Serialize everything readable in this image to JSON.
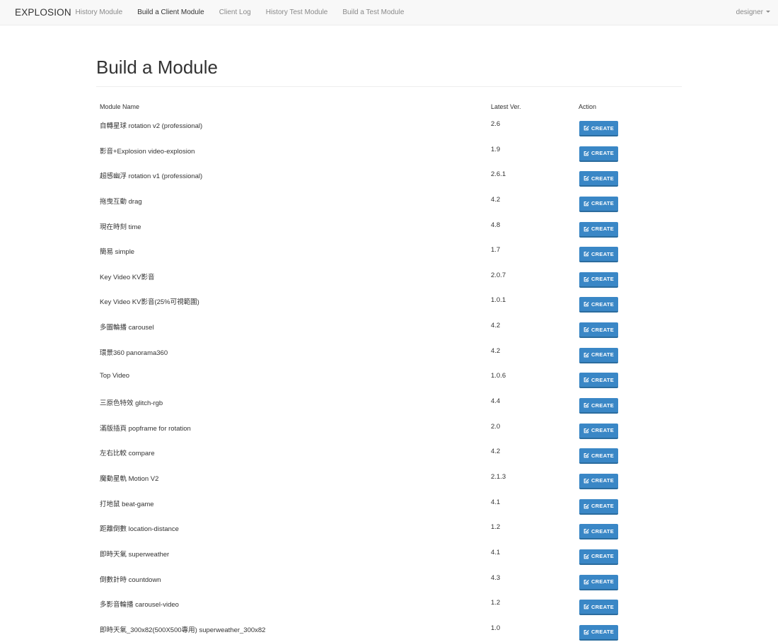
{
  "navbar": {
    "brand": "EXPLOSION",
    "links": [
      {
        "label": "History Module",
        "active": false
      },
      {
        "label": "Build a Client Module",
        "active": true
      },
      {
        "label": "Client Log",
        "active": false
      },
      {
        "label": "History Test Module",
        "active": false
      },
      {
        "label": "Build a Test Module",
        "active": false
      }
    ],
    "user": "designer"
  },
  "page": {
    "title": "Build a Module"
  },
  "table": {
    "headers": {
      "name": "Module Name",
      "version": "Latest Ver.",
      "action": "Action"
    },
    "action_label": "CREATE",
    "action_icon": "check-square-icon",
    "rows": [
      {
        "name": "自轉星球 rotation v2 (professional)",
        "version": "2.6"
      },
      {
        "name": "影音+Explosion video-explosion",
        "version": "1.9"
      },
      {
        "name": "超感幽浮 rotation v1 (professional)",
        "version": "2.6.1"
      },
      {
        "name": "拖曳互動 drag",
        "version": "4.2"
      },
      {
        "name": "現在時刻 time",
        "version": "4.8"
      },
      {
        "name": "簡易 simple",
        "version": "1.7"
      },
      {
        "name": "Key Video KV影音",
        "version": "2.0.7"
      },
      {
        "name": "Key Video KV影音(25%可視範圍)",
        "version": "1.0.1"
      },
      {
        "name": "多圖輪播 carousel",
        "version": "4.2"
      },
      {
        "name": "環景360 panorama360",
        "version": "4.2"
      },
      {
        "name": "Top Video",
        "version": "1.0.6"
      },
      {
        "name": "三原色特效 glitch-rgb",
        "version": "4.4"
      },
      {
        "name": "滿版插頁 popframe for rotation",
        "version": "2.0"
      },
      {
        "name": "左右比較 compare",
        "version": "4.2"
      },
      {
        "name": "魔動星軌 Motion V2",
        "version": "2.1.3"
      },
      {
        "name": "打地鼠 beat-game",
        "version": "4.1"
      },
      {
        "name": "距離倒數 location-distance",
        "version": "1.2"
      },
      {
        "name": "即時天氣 superweather",
        "version": "4.1"
      },
      {
        "name": "倒數計時 countdown",
        "version": "4.3"
      },
      {
        "name": "多影音輪播 carousel-video",
        "version": "1.2"
      },
      {
        "name": "即時天氣_300x82(500X500專用) superweather_300x82",
        "version": "1.0"
      }
    ]
  },
  "colors": {
    "accent": "#3a87c6",
    "navbar_bg": "#f8f8f8",
    "text": "#333333",
    "muted": "#8a8a8a"
  }
}
